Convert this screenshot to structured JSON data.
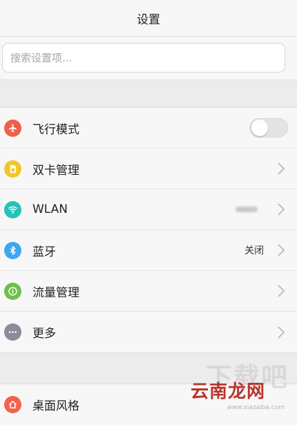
{
  "header": {
    "title": "设置"
  },
  "search": {
    "placeholder": "搜索设置项..."
  },
  "group1": [
    {
      "id": "airplane",
      "label": "飞行模式",
      "icon": "airplane-icon",
      "color": "#ef5f48",
      "control": "toggle",
      "toggle_on": false
    },
    {
      "id": "dual-sim",
      "label": "双卡管理",
      "icon": "sim-card-icon",
      "color": "#f4c528",
      "control": "chevron"
    },
    {
      "id": "wlan",
      "label": "WLAN",
      "icon": "wifi-icon",
      "color": "#26c2b9",
      "control": "chevron",
      "value_obscured": true
    },
    {
      "id": "bluetooth",
      "label": "蓝牙",
      "icon": "bluetooth-icon",
      "color": "#3ea8f0",
      "control": "chevron",
      "value": "关闭"
    },
    {
      "id": "data-usage",
      "label": "流量管理",
      "icon": "gauge-icon",
      "color": "#6cc14a",
      "control": "chevron"
    },
    {
      "id": "more",
      "label": "更多",
      "icon": "more-dots-icon",
      "color": "#8a8d99",
      "control": "chevron"
    }
  ],
  "group2": [
    {
      "id": "desktop-style",
      "label": "桌面风格",
      "icon": "home-icon",
      "color": "#f2634a"
    }
  ],
  "watermark": {
    "top": "下载吧",
    "main": "云南龙网",
    "url": "www.xiazaiba.com"
  }
}
